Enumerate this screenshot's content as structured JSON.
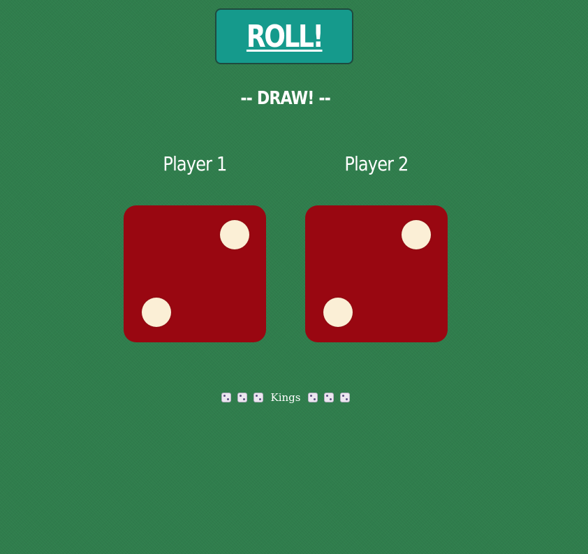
{
  "roll_button": {
    "label": "ROLL!"
  },
  "result": {
    "text": "-- DRAW! --"
  },
  "players": [
    {
      "name": "Player 1",
      "die_value": 2,
      "die_color": "#990711",
      "pip_color": "#fbefd6"
    },
    {
      "name": "Player 2",
      "die_value": 2,
      "die_color": "#990711",
      "pip_color": "#fbefd6"
    }
  ],
  "footer": {
    "label": "Kings",
    "left_icons": [
      "dice-icon",
      "dice-icon",
      "dice-icon"
    ],
    "right_icons": [
      "dice-icon",
      "dice-icon",
      "dice-icon"
    ]
  },
  "colors": {
    "background": "#2f7d4c",
    "button": "#159a8c",
    "text": "#ffffff"
  }
}
